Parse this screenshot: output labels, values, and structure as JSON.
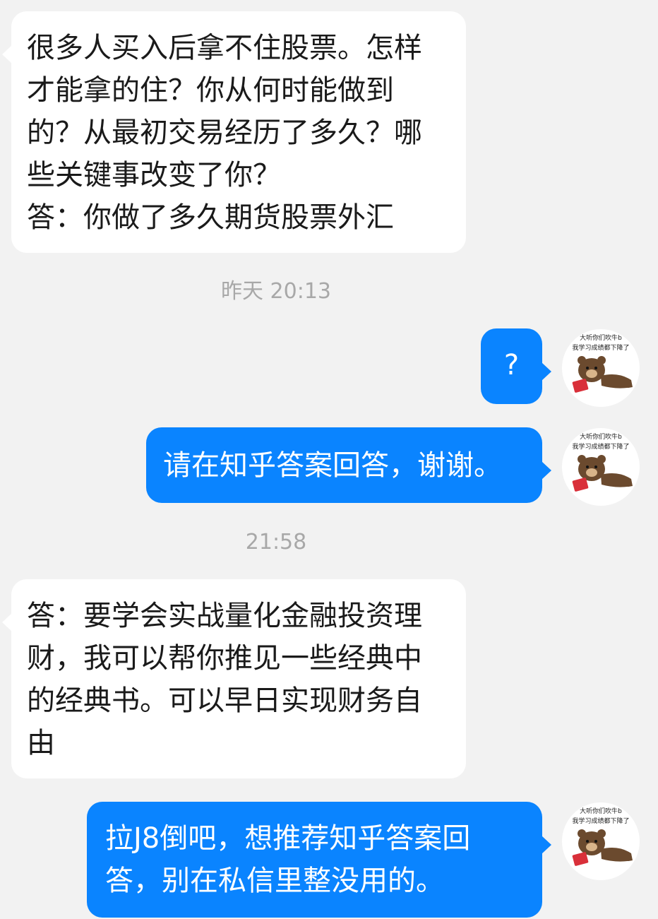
{
  "chat": {
    "timestamps": [
      "昨天 20:13",
      "21:58"
    ],
    "messages": [
      {
        "from": "other",
        "text": "很多人买入后拿不住股票。怎样\n才能拿的住？你从何时能做到\n的？从最初交易经历了多久？哪\n些关键事改变了你？\n答：你做了多久期货股票外汇"
      },
      {
        "from": "me",
        "text": "?"
      },
      {
        "from": "me",
        "text": "请在知乎答案回答，谢谢。"
      },
      {
        "from": "other",
        "text": "答：要学会实战量化金融投资理\n财，我可以帮你推见一些经典中\n的经典书。可以早日实现财务自\n由"
      },
      {
        "from": "me",
        "text": "拉J8倒吧，想推荐知乎答案回\n答，别在私信里整没用的。"
      }
    ]
  },
  "avatar": {
    "icon": "bear-meme-avatar-icon",
    "caption_line1": "大听你们吹牛b",
    "caption_line2": "我学习成绩都下降了"
  },
  "colors": {
    "background": "#f2f2f2",
    "incoming_bubble": "#ffffff",
    "outgoing_bubble": "#0a84ff",
    "timestamp_text": "#a8a8a8"
  }
}
